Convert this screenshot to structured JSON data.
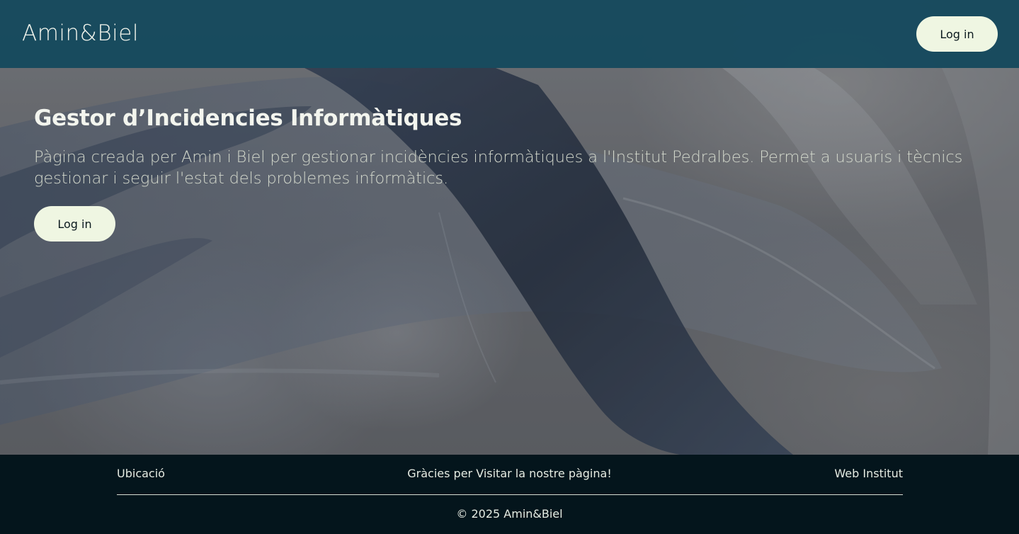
{
  "header": {
    "brand": "Amin&Biel",
    "login_label": "Log in"
  },
  "hero": {
    "title": "Gestor d’Incidencies Informàtiques",
    "description": "Pàgina creada per Amin i Biel per gestionar incidències informàtiques a l'Institut Pedralbes. Permet a usuaris i tècnics gestionar i seguir l'estat dels problemes informàtics.",
    "login_label": "Log in"
  },
  "footer": {
    "left_link": "Ubicació",
    "center_text": "Gràcies per Visitar la nostre pàgina!",
    "right_link": "Web Institut",
    "copyright": "© 2025 Amin&Biel"
  },
  "colors": {
    "header_bg": "#12485c",
    "button_bg": "#eff6e2",
    "footer_bg": "#04151c",
    "title_text": "#f3f5ee",
    "description_text": "#d3d8cc"
  }
}
